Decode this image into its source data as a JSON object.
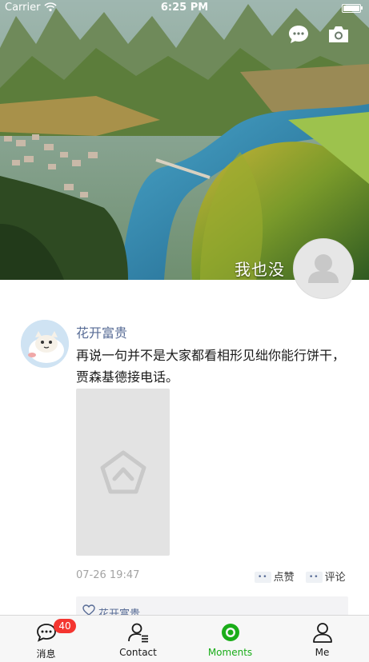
{
  "status_bar": {
    "carrier": "Carrier",
    "time": "6:25 PM"
  },
  "cover": {
    "name": "我也没"
  },
  "post": {
    "author": "花开富贵",
    "text": "再说一句并不是大家都看相形见绌你能行饼干，贾森基德接电话。",
    "time": "07-26 19:47",
    "like_label": "点赞",
    "comment_label": "评论",
    "action_dots": "••",
    "likes": [
      "花开富贵"
    ]
  },
  "tabbar": {
    "tabs": [
      {
        "label": "消息",
        "icon": "chat-bubble-icon",
        "badge": "40"
      },
      {
        "label": "Contact",
        "icon": "contact-icon"
      },
      {
        "label": "Moments",
        "icon": "moments-icon",
        "active": true
      },
      {
        "label": "Me",
        "icon": "person-icon"
      }
    ]
  },
  "colors": {
    "accent": "#1aad19",
    "link": "#576b95",
    "badge": "#f43530"
  }
}
